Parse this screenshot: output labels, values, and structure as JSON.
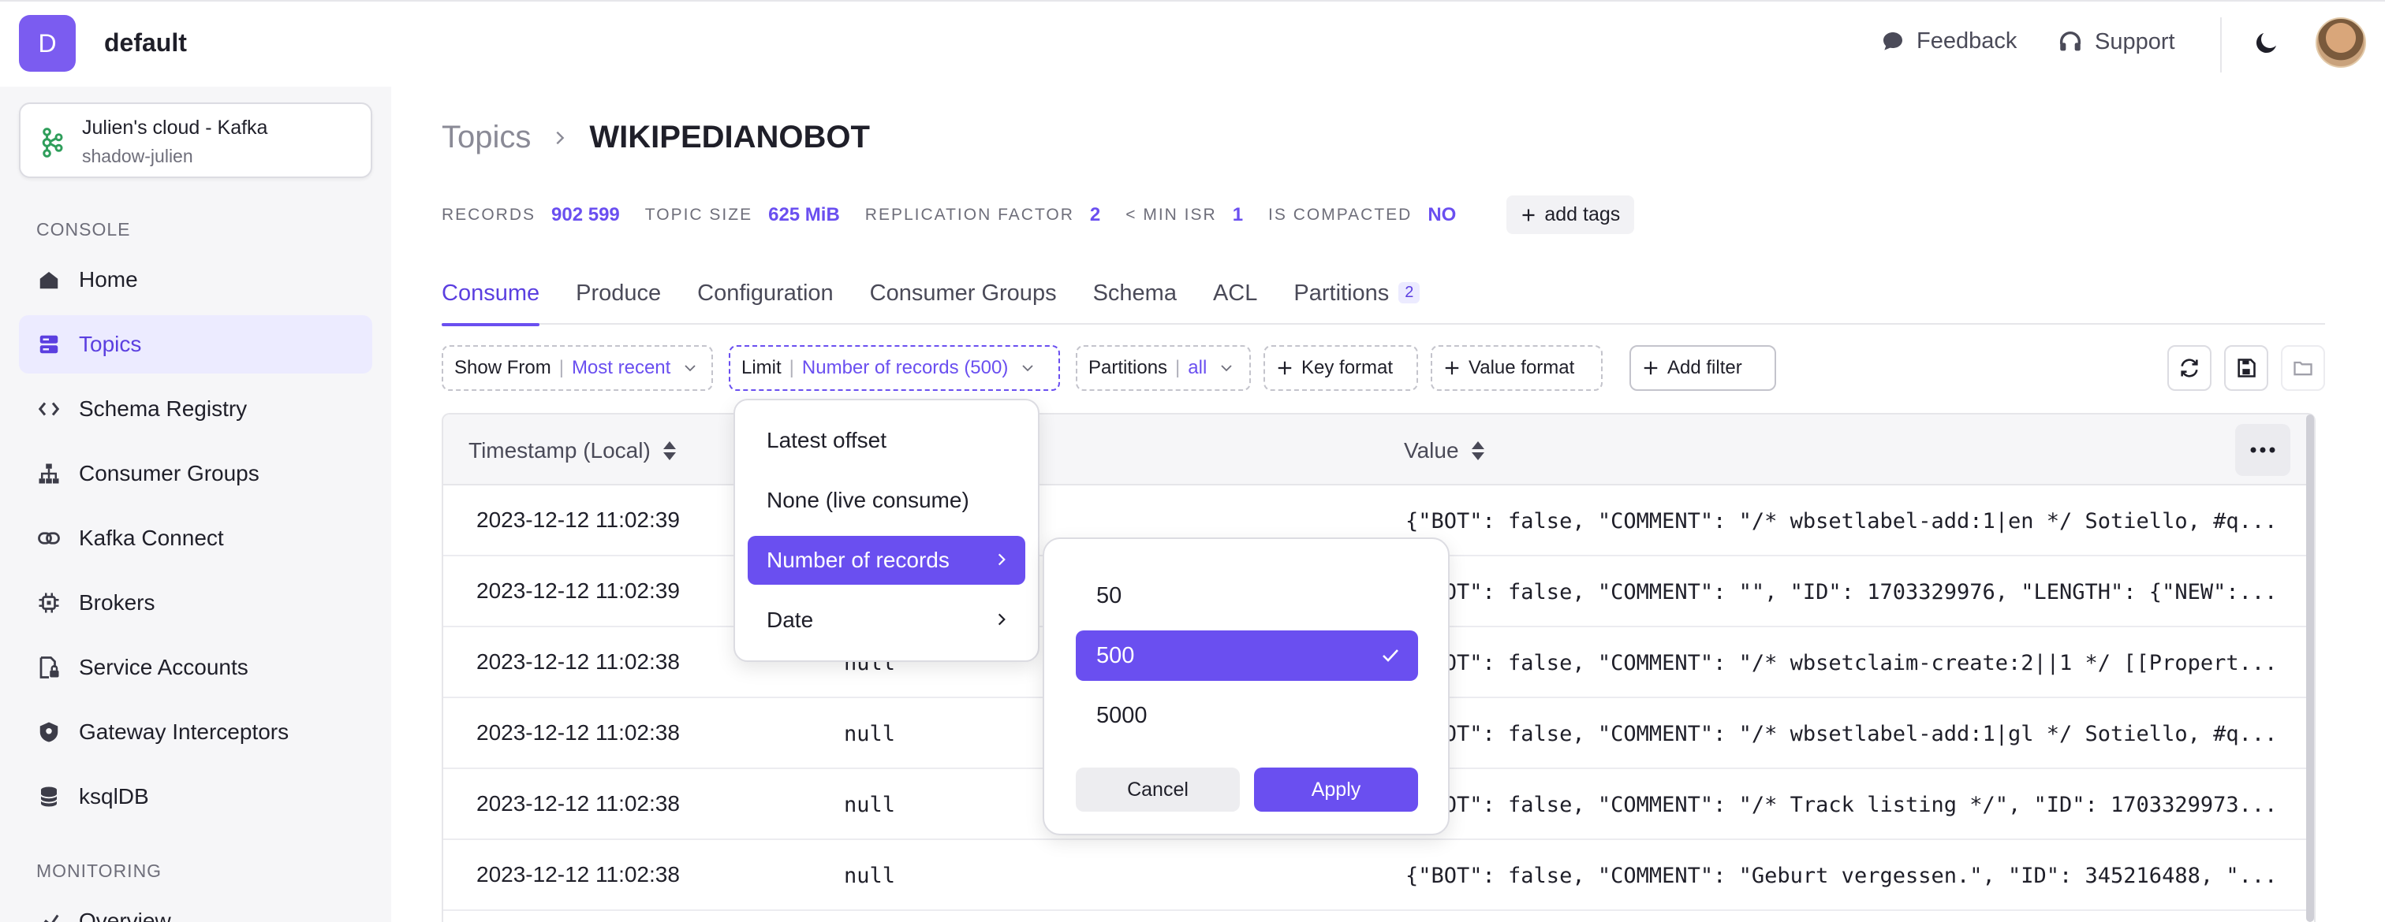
{
  "org": {
    "initial": "D",
    "name": "default"
  },
  "top_actions": {
    "feedback": "Feedback",
    "support": "Support"
  },
  "cluster": {
    "name": "Julien's cloud - Kafka",
    "sub": "shadow-julien"
  },
  "sidebar": {
    "console_label": "CONSOLE",
    "items": [
      {
        "label": "Home",
        "icon": "home-icon"
      },
      {
        "label": "Topics",
        "icon": "topics-icon"
      },
      {
        "label": "Schema Registry",
        "icon": "code-icon"
      },
      {
        "label": "Consumer Groups",
        "icon": "hierarchy-icon"
      },
      {
        "label": "Kafka Connect",
        "icon": "link-icon"
      },
      {
        "label": "Brokers",
        "icon": "chip-icon"
      },
      {
        "label": "Service Accounts",
        "icon": "lock-file-icon"
      },
      {
        "label": "Gateway Interceptors",
        "icon": "shield-icon"
      },
      {
        "label": "ksqlDB",
        "icon": "database-icon"
      }
    ],
    "monitoring_label": "MONITORING",
    "monitoring_items": [
      {
        "label": "Overview",
        "icon": "chart-icon"
      }
    ]
  },
  "breadcrumb": {
    "parent": "Topics",
    "current": "WIKIPEDIANOBOT"
  },
  "stats": {
    "records_label": "RECORDS",
    "records": "902 599",
    "size_label": "TOPIC SIZE",
    "size": "625 MiB",
    "replication_label": "REPLICATION FACTOR",
    "replication": "2",
    "minisr_label": "< MIN ISR",
    "minisr": "1",
    "compacted_label": "IS COMPACTED",
    "compacted": "NO",
    "add_tags": "add tags"
  },
  "tabs": [
    {
      "label": "Consume"
    },
    {
      "label": "Produce"
    },
    {
      "label": "Configuration"
    },
    {
      "label": "Consumer Groups"
    },
    {
      "label": "Schema"
    },
    {
      "label": "ACL"
    },
    {
      "label": "Partitions",
      "badge": "2"
    }
  ],
  "toolbar": {
    "show_from": "Show From",
    "show_from_value": "Most recent",
    "limit": "Limit",
    "limit_value": "Number of records (500)",
    "partitions": "Partitions",
    "partitions_value": "all",
    "key_format": "Key format",
    "value_format": "Value format",
    "add_filter": "Add filter"
  },
  "table": {
    "headers": {
      "timestamp": "Timestamp (Local)",
      "value": "Value"
    },
    "rows": [
      {
        "ts": "2023-12-12 11:02:39",
        "key": "",
        "value": "{\"BOT\": false, \"COMMENT\": \"/* wbsetlabel-add:1|en */ Sotiello, #q..."
      },
      {
        "ts": "2023-12-12 11:02:39",
        "key": "",
        "value": "{\"BOT\": false, \"COMMENT\": \"\", \"ID\": 1703329976, \"LENGTH\": {\"NEW\":..."
      },
      {
        "ts": "2023-12-12 11:02:38",
        "key": "null",
        "value": "{\"BOT\": false, \"COMMENT\": \"/* wbsetclaim-create:2||1 */ [[Propert..."
      },
      {
        "ts": "2023-12-12 11:02:38",
        "key": "null",
        "value": "{\"BOT\": false, \"COMMENT\": \"/* wbsetlabel-add:1|gl */ Sotiello, #q..."
      },
      {
        "ts": "2023-12-12 11:02:38",
        "key": "null",
        "value": "{\"BOT\": false, \"COMMENT\": \"/* Track listing */\", \"ID\": 1703329973..."
      },
      {
        "ts": "2023-12-12 11:02:38",
        "key": "null",
        "value": "{\"BOT\": false, \"COMMENT\": \"Geburt vergessen.\", \"ID\": 345216488, \"..."
      }
    ]
  },
  "limit_menu": {
    "items": [
      {
        "label": "Latest offset"
      },
      {
        "label": "None (live consume)"
      },
      {
        "label": "Number of records",
        "active": true
      },
      {
        "label": "Date"
      }
    ]
  },
  "records_submenu": {
    "options": [
      "50",
      "500",
      "5000"
    ],
    "selected": "500",
    "cancel": "Cancel",
    "apply": "Apply"
  },
  "colors": {
    "accent": "#6a4ff0",
    "accent_light": "#ecebff"
  }
}
